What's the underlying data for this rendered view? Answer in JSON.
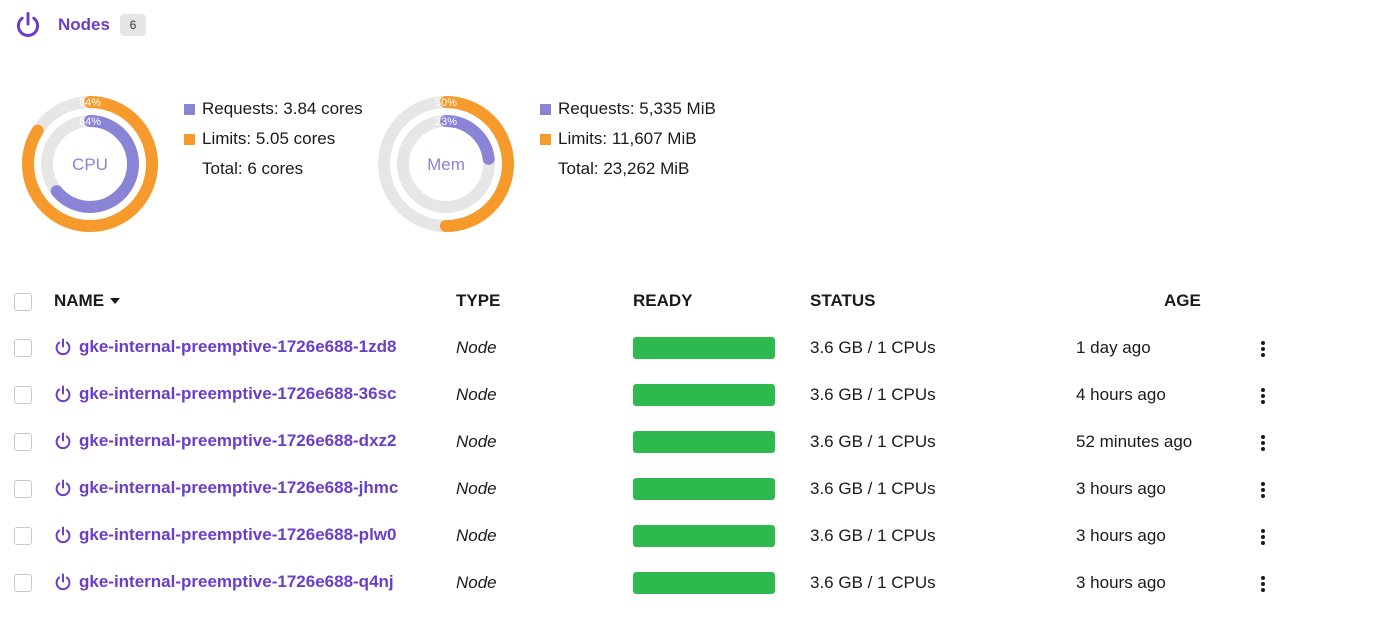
{
  "header": {
    "title": "Nodes",
    "count": "6",
    "icon": "power-icon"
  },
  "colors": {
    "accent": "#6a3ec9",
    "requests": "#8a84d6",
    "limits": "#f79a2c",
    "ready": "#2eb94f",
    "track": "#e6e6e6"
  },
  "cpu": {
    "label": "CPU",
    "requests_label": "Requests: 3.84 cores",
    "limits_label": "Limits: 5.05 cores",
    "total_label": "Total: 6 cores",
    "requests_pct": 64,
    "limits_pct": 84,
    "requests_pct_label": "64%",
    "limits_pct_label": "84%"
  },
  "mem": {
    "label": "Mem",
    "requests_label": "Requests: 5,335 MiB",
    "limits_label": "Limits: 11,607 MiB",
    "total_label": "Total: 23,262 MiB",
    "requests_pct": 23,
    "limits_pct": 50,
    "requests_pct_label": "23%",
    "limits_pct_label": "50%"
  },
  "table": {
    "columns": {
      "name": "NAME",
      "type": "TYPE",
      "ready": "READY",
      "status": "STATUS",
      "age": "AGE"
    },
    "rows": [
      {
        "name": "gke-internal-preemptive-1726e688-1zd8",
        "type": "Node",
        "ready": 1.0,
        "status": "3.6 GB / 1 CPUs",
        "age": "1 day ago"
      },
      {
        "name": "gke-internal-preemptive-1726e688-36sc",
        "type": "Node",
        "ready": 1.0,
        "status": "3.6 GB / 1 CPUs",
        "age": "4 hours ago"
      },
      {
        "name": "gke-internal-preemptive-1726e688-dxz2",
        "type": "Node",
        "ready": 1.0,
        "status": "3.6 GB / 1 CPUs",
        "age": "52 minutes ago"
      },
      {
        "name": "gke-internal-preemptive-1726e688-jhmc",
        "type": "Node",
        "ready": 1.0,
        "status": "3.6 GB / 1 CPUs",
        "age": "3 hours ago"
      },
      {
        "name": "gke-internal-preemptive-1726e688-plw0",
        "type": "Node",
        "ready": 1.0,
        "status": "3.6 GB / 1 CPUs",
        "age": "3 hours ago"
      },
      {
        "name": "gke-internal-preemptive-1726e688-q4nj",
        "type": "Node",
        "ready": 1.0,
        "status": "3.6 GB / 1 CPUs",
        "age": "3 hours ago"
      }
    ]
  }
}
